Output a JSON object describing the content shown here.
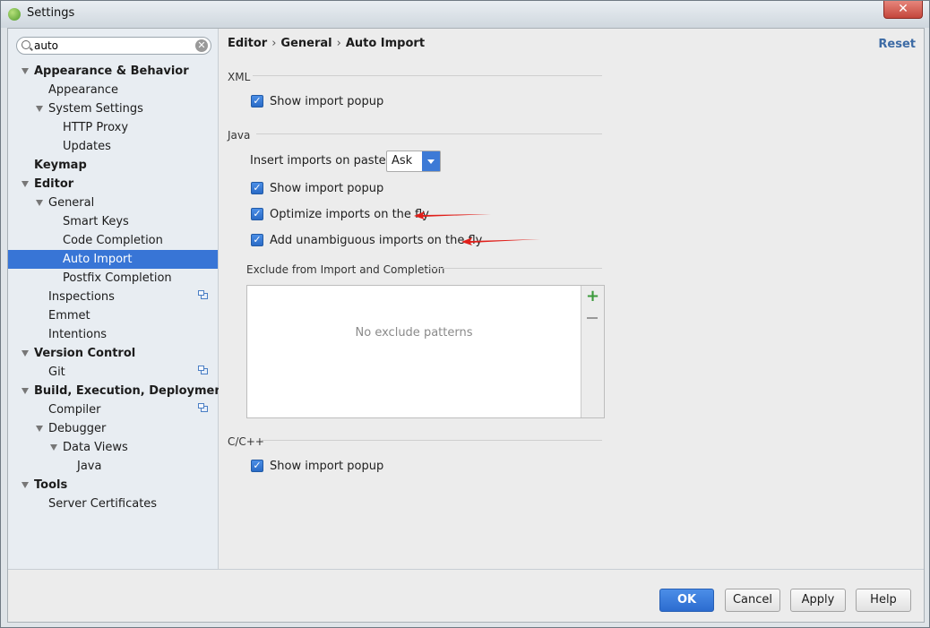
{
  "window": {
    "title": "Settings",
    "close_glyph": "✕"
  },
  "search": {
    "value": "auto",
    "clear_glyph": "✕"
  },
  "sidebar": {
    "items": [
      {
        "label": "Appearance & Behavior"
      },
      {
        "label": "Appearance"
      },
      {
        "label": "System Settings"
      },
      {
        "label": "HTTP Proxy"
      },
      {
        "label": "Updates"
      },
      {
        "label": "Keymap"
      },
      {
        "label": "Editor"
      },
      {
        "label": "General"
      },
      {
        "label": "Smart Keys"
      },
      {
        "label": "Code Completion"
      },
      {
        "label": "Auto Import"
      },
      {
        "label": "Postfix Completion"
      },
      {
        "label": "Inspections"
      },
      {
        "label": "Emmet"
      },
      {
        "label": "Intentions"
      },
      {
        "label": "Version Control"
      },
      {
        "label": "Git"
      },
      {
        "label": "Build, Execution, Deployment"
      },
      {
        "label": "Compiler"
      },
      {
        "label": "Debugger"
      },
      {
        "label": "Data Views"
      },
      {
        "label": "Java"
      },
      {
        "label": "Tools"
      },
      {
        "label": "Server Certificates"
      }
    ]
  },
  "breadcrumb": {
    "parts": [
      "Editor",
      "General",
      "Auto Import"
    ],
    "separator": "›"
  },
  "reset_label": "Reset",
  "xml_section": {
    "title": "XML",
    "show_popup_label": "Show import popup",
    "show_popup_checked": true
  },
  "java_section": {
    "title": "Java",
    "insert_label": "Insert imports on paste:",
    "insert_value": "Ask",
    "show_popup_label": "Show import popup",
    "optimize_label": "Optimize imports on the fly",
    "unambiguous_label": "Add unambiguous imports on the fly"
  },
  "exclude_section": {
    "title": "Exclude from Import and Completion",
    "empty_text": "No exclude patterns",
    "add_glyph": "+"
  },
  "cpp_section": {
    "title": "C/C++",
    "show_popup_label": "Show import popup"
  },
  "buttons": {
    "ok": "OK",
    "cancel": "Cancel",
    "apply": "Apply",
    "help": "Help"
  },
  "colors": {
    "selection": "#3875d6",
    "annotation_arrow": "#e0201b",
    "primary_button": "#2c6ccf"
  }
}
